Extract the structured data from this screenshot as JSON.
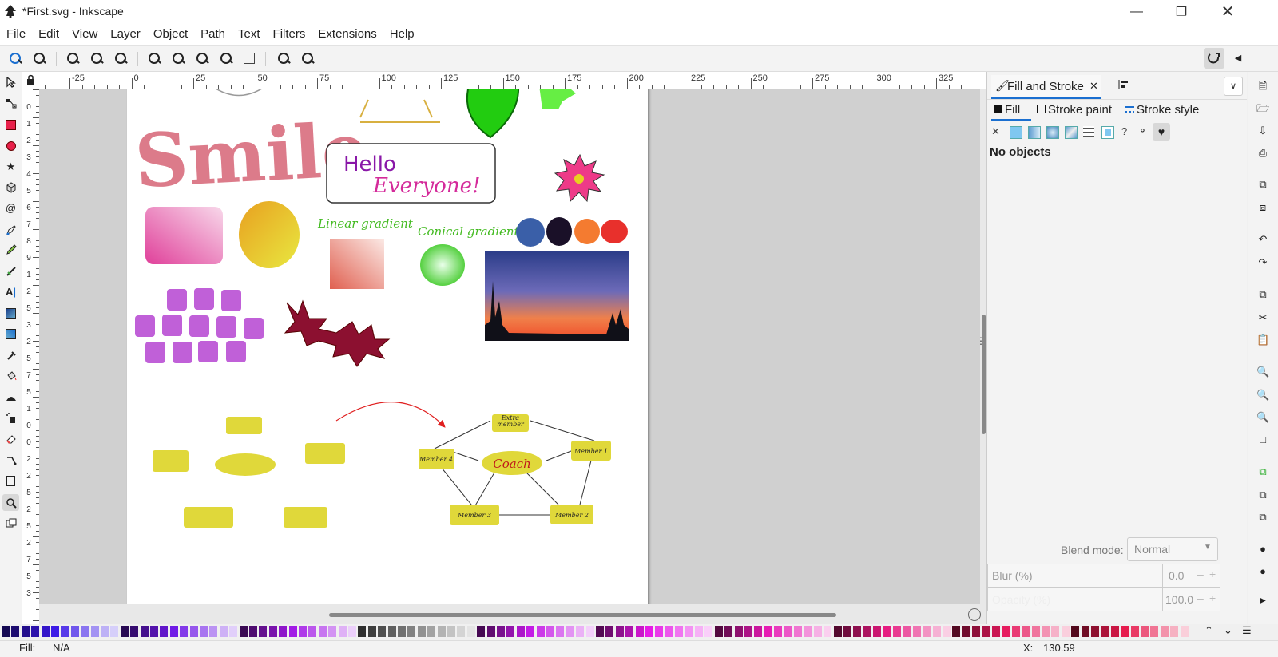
{
  "window": {
    "title": "*First.svg - Inkscape",
    "min_icon": "minimize-icon",
    "max_icon": "restore-icon",
    "close_icon": "close-icon"
  },
  "menu": [
    "File",
    "Edit",
    "View",
    "Layer",
    "Object",
    "Path",
    "Text",
    "Filters",
    "Extensions",
    "Help"
  ],
  "ruler": {
    "h_labels": [
      "-25",
      "0",
      "25",
      "50",
      "75",
      "100",
      "125",
      "150",
      "175",
      "200",
      "225",
      "250",
      "275",
      "300",
      "325"
    ],
    "v_labels": [
      "0",
      "1",
      "2",
      "3",
      "4",
      "5",
      "6",
      "7",
      "8",
      "9",
      "1",
      "2",
      "5",
      "3",
      "2",
      "5",
      "7",
      "5",
      "1",
      "0",
      "0",
      "2",
      "2",
      "5",
      "2",
      "5",
      "2",
      "7",
      "5",
      "3"
    ]
  },
  "canvas": {
    "smile_text": "Smile",
    "hello_line1": "Hello",
    "hello_line2": "Everyone!",
    "linear_caption": "Linear gradient",
    "conical_caption": "Conical gradient",
    "node_extra": "Extra member",
    "node_coach": "Coach",
    "node_m1": "Member 1",
    "node_m2": "Member 2",
    "node_m3": "Member 3",
    "node_m4": "Member 4",
    "circle_colors": [
      "#3a5fa8",
      "#1a1028",
      "#f47b30",
      "#e8302c"
    ],
    "accent": "#c060c0"
  },
  "dialog": {
    "tab_title": "Fill and Stroke",
    "sub_tabs": [
      "Fill",
      "Stroke paint",
      "Stroke style"
    ],
    "status": "No objects",
    "blend_label": "Blend mode:",
    "blend_value": "Normal",
    "blur_label": "Blur (%)",
    "blur_value": "0.0",
    "opacity_label": "Opacity (%)",
    "opacity_value": "100.0"
  },
  "status": {
    "fill_label": "Fill:",
    "fill_value": "N/A",
    "x_label": "X:",
    "x_value": "130.59"
  }
}
